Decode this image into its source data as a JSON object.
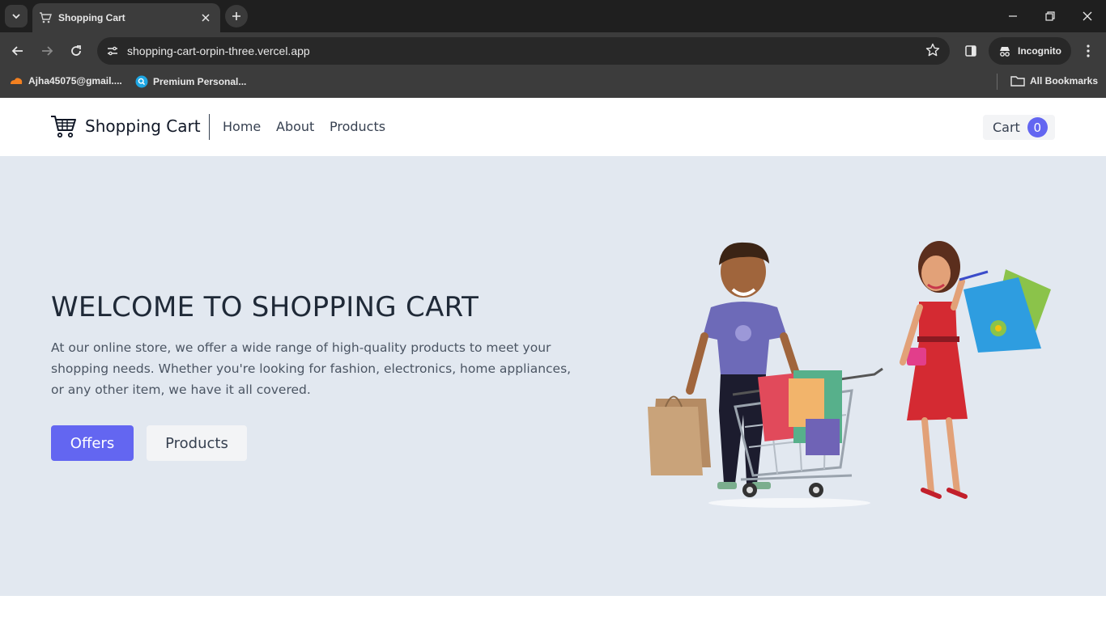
{
  "browser": {
    "tab_title": "Shopping Cart",
    "url": "shopping-cart-orpin-three.vercel.app",
    "incognito_label": "Incognito",
    "bookmarks": [
      {
        "label": "Ajha45075@gmail...."
      },
      {
        "label": "Premium Personal..."
      }
    ],
    "all_bookmarks_label": "All Bookmarks"
  },
  "navbar": {
    "brand": "Shopping Cart",
    "links": [
      "Home",
      "About",
      "Products"
    ],
    "cart_label": "Cart",
    "cart_count": "0"
  },
  "hero": {
    "title": "WELCOME TO SHOPPING CART",
    "description": "At our online store, we offer a wide range of high-quality products to meet your shopping needs. Whether you're looking for fashion, electronics, home appliances, or any other item, we have it all covered.",
    "offers_button": "Offers",
    "products_button": "Products"
  },
  "colors": {
    "accent": "#6366f1",
    "hero_bg": "#e2e8f0",
    "chrome_dark": "#1f1f1f",
    "chrome_toolbar": "#3c3c3c"
  },
  "icons": [
    "tab-search-icon",
    "cart-favicon-icon",
    "close-icon",
    "plus-icon",
    "minimize-icon",
    "restore-icon",
    "window-close-icon",
    "back-icon",
    "forward-icon",
    "reload-icon",
    "site-info-icon",
    "star-icon",
    "sidepanel-icon",
    "incognito-icon",
    "menu-icon",
    "folder-icon",
    "shopping-cart-logo-icon"
  ]
}
